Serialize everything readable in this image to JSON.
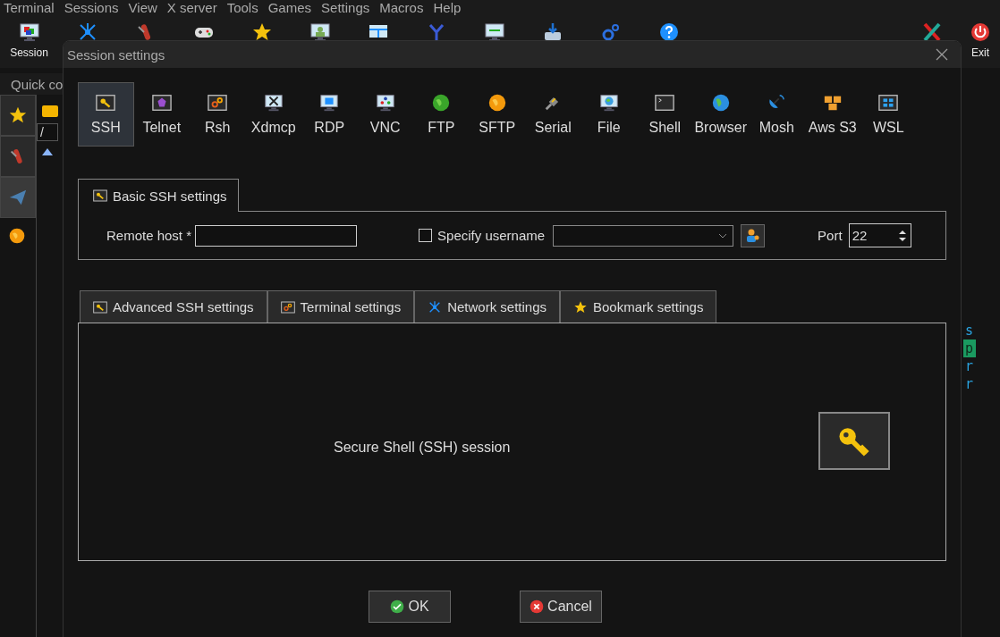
{
  "menu": [
    "Terminal",
    "Sessions",
    "View",
    "X server",
    "Tools",
    "Games",
    "Settings",
    "Macros",
    "Help"
  ],
  "toolbar": [
    {
      "kind": "session",
      "label": "Session"
    },
    {
      "kind": "network"
    },
    {
      "kind": "tools"
    },
    {
      "kind": "games"
    },
    {
      "kind": "star"
    },
    {
      "kind": "user"
    },
    {
      "kind": "split"
    },
    {
      "kind": "fork"
    },
    {
      "kind": "transfer"
    },
    {
      "kind": "download"
    },
    {
      "kind": "gears"
    },
    {
      "kind": "help"
    },
    {
      "kind": "gap"
    },
    {
      "kind": "x"
    },
    {
      "kind": "exit",
      "label": "Exit"
    }
  ],
  "quick_connect": {
    "placeholder": "Quick co"
  },
  "sidebar": {
    "tabs": [
      {
        "kind": "star",
        "selected": false
      },
      {
        "kind": "tools",
        "selected": false
      },
      {
        "kind": "send",
        "selected": true
      }
    ],
    "path": "/"
  },
  "terminal_fragments": [
    {
      "text": "s",
      "highlighted": false
    },
    {
      "text": "p",
      "highlighted": true
    },
    {
      "text": "r",
      "highlighted": false
    },
    {
      "text": "r",
      "highlighted": false
    }
  ],
  "dialog": {
    "title": "Session settings",
    "session_types": [
      {
        "kind": "ssh",
        "label": "SSH",
        "selected": true
      },
      {
        "kind": "telnet",
        "label": "Telnet",
        "selected": false
      },
      {
        "kind": "rsh",
        "label": "Rsh",
        "selected": false
      },
      {
        "kind": "xdmcp",
        "label": "Xdmcp",
        "selected": false
      },
      {
        "kind": "rdp",
        "label": "RDP",
        "selected": false
      },
      {
        "kind": "vnc",
        "label": "VNC",
        "selected": false
      },
      {
        "kind": "ftp",
        "label": "FTP",
        "selected": false
      },
      {
        "kind": "sftp",
        "label": "SFTP",
        "selected": false
      },
      {
        "kind": "serial",
        "label": "Serial",
        "selected": false
      },
      {
        "kind": "file",
        "label": "File",
        "selected": false
      },
      {
        "kind": "shell",
        "label": "Shell",
        "selected": false
      },
      {
        "kind": "browser",
        "label": "Browser",
        "selected": false
      },
      {
        "kind": "mosh",
        "label": "Mosh",
        "selected": false
      },
      {
        "kind": "awss3",
        "label": "Aws S3",
        "selected": false
      },
      {
        "kind": "wsl",
        "label": "WSL",
        "selected": false
      }
    ],
    "basic_tab": {
      "label": "Basic SSH settings"
    },
    "remote_host": {
      "label": "Remote host *"
    },
    "specify_username": {
      "label": "Specify username",
      "checked": false
    },
    "port": {
      "label": "Port",
      "value": "22"
    },
    "lower_tabs": [
      {
        "kind": "ssh",
        "label": "Advanced SSH settings"
      },
      {
        "kind": "terminal",
        "label": "Terminal settings"
      },
      {
        "kind": "network",
        "label": "Network settings"
      },
      {
        "kind": "star",
        "label": "Bookmark settings"
      }
    ],
    "description": "Secure Shell (SSH) session",
    "buttons": [
      {
        "kind": "ok",
        "label": "OK"
      },
      {
        "kind": "cancel",
        "label": "Cancel"
      }
    ]
  }
}
